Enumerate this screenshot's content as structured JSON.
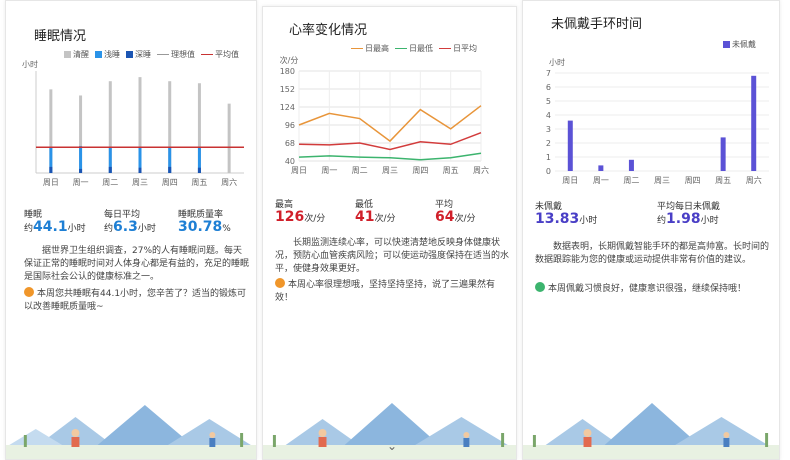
{
  "sleep": {
    "title": "睡眠情况",
    "legend": [
      {
        "label": "清醒",
        "color": "#c4c4c4",
        "kind": "box"
      },
      {
        "label": "浅睡",
        "color": "#2a93e8",
        "kind": "box"
      },
      {
        "label": "深睡",
        "color": "#1b55b3",
        "kind": "box"
      },
      {
        "label": "理想值",
        "color": "#999999",
        "kind": "line"
      },
      {
        "label": "平均值",
        "color": "#c83232",
        "kind": "line"
      }
    ],
    "ylabel": "小时",
    "stat1_label": "睡眠",
    "stat1_prefix": "约",
    "stat1_value": "44.1",
    "stat1_unit": "小时",
    "stat2_label": "每日平均",
    "stat2_prefix": "约",
    "stat2_value": "6.3",
    "stat2_unit": "小时",
    "stat3_label": "睡眠质量率",
    "stat3_value": "30.78",
    "stat3_unit": "%",
    "paragraph": "据世界卫生组织调查，27%的人有睡眠问题。每天保证正常的睡眠时间对人体身心都是有益的，充足的睡眠是国际社会公认的健康标准之一。",
    "note": "本周您共睡眠有44.1小时，您辛苦了？适当的锻炼可以改善睡眠质量哦~"
  },
  "heart": {
    "title": "心率变化情况",
    "legend": [
      {
        "label": "日最高",
        "color": "#e8953a"
      },
      {
        "label": "日最低",
        "color": "#3cb46e"
      },
      {
        "label": "日平均",
        "color": "#d23c3c"
      }
    ],
    "ylabel": "次/分",
    "stat1_label": "最高",
    "stat1_value": "126",
    "stat1_unit": "次/分",
    "stat2_label": "最低",
    "stat2_value": "41",
    "stat2_unit": "次/分",
    "stat3_label": "平均",
    "stat3_value": "64",
    "stat3_unit": "次/分",
    "paragraph": "长期监测连续心率，可以快速清楚地反映身体健康状况，预防心血管疾病风险；可以使运动强度保持在适当的水平，使健身效果更好。",
    "note": "本周心率很理想哦，坚持坚持坚持，说了三遍果然有效！"
  },
  "wear": {
    "title": "未佩戴手环时间",
    "legend": [
      {
        "label": "未佩戴",
        "color": "#5b52d6"
      }
    ],
    "ylabel": "小时",
    "stat1_label": "未佩戴",
    "stat1_value": "13.83",
    "stat1_unit": "小时",
    "stat2_label": "平均每日未佩戴",
    "stat2_prefix": "约",
    "stat2_value": "1.98",
    "stat2_unit": "小时",
    "paragraph": "数据表明，长期佩戴智能手环的都是高帅富。长时间的数据跟踪能为您的健康或运动提供非常有价值的建议。",
    "note": "本周佩戴习惯良好，健康意识很强，继续保持哦！"
  },
  "chart_data": [
    {
      "type": "bar",
      "title": "睡眠情况",
      "ylabel": "小时",
      "categories": [
        "周日",
        "周一",
        "周二",
        "周三",
        "周四",
        "周五",
        "周六"
      ],
      "ylim": [
        0,
        25
      ],
      "series": [
        {
          "name": "清醒",
          "values": [
            20.5,
            19,
            22.5,
            23.5,
            22.5,
            22,
            17
          ]
        },
        {
          "name": "浅睡",
          "values": [
            6.3,
            6.6,
            6.5,
            6.5,
            6.5,
            6.5,
            0
          ]
        },
        {
          "name": "深睡",
          "values": [
            1.5,
            1.0,
            1.5,
            1.3,
            1.5,
            1.3,
            0
          ]
        }
      ],
      "average": 6.3
    },
    {
      "type": "line",
      "title": "心率变化情况",
      "ylabel": "次/分",
      "categories": [
        "周日",
        "周一",
        "周二",
        "周三",
        "周四",
        "周五",
        "周六"
      ],
      "yticks": [
        40,
        68,
        96,
        124,
        152,
        180
      ],
      "ylim": [
        40,
        180
      ],
      "series": [
        {
          "name": "日最高",
          "values": [
            96,
            114,
            106,
            71,
            120,
            90,
            126
          ]
        },
        {
          "name": "日最低",
          "values": [
            46,
            48,
            46,
            45,
            42,
            45,
            52
          ]
        },
        {
          "name": "日平均",
          "values": [
            66,
            65,
            68,
            58,
            70,
            66,
            84
          ]
        }
      ]
    },
    {
      "type": "bar",
      "title": "未佩戴手环时间",
      "ylabel": "小时",
      "categories": [
        "周日",
        "周一",
        "周二",
        "周三",
        "周四",
        "周五",
        "周六"
      ],
      "yticks": [
        0,
        1,
        2,
        3,
        4,
        5,
        6,
        7
      ],
      "ylim": [
        0,
        7
      ],
      "series": [
        {
          "name": "未佩戴",
          "values": [
            3.6,
            0.4,
            0.8,
            0,
            0,
            2.4,
            6.8
          ]
        }
      ]
    }
  ]
}
